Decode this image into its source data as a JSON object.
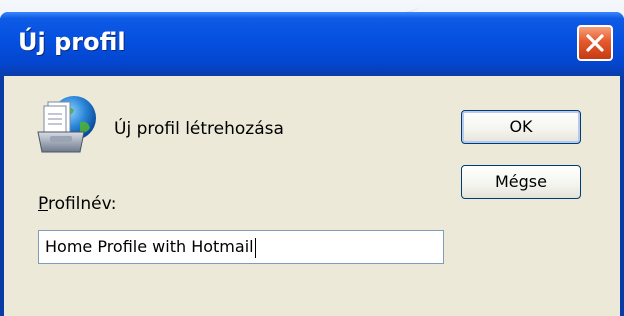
{
  "dialog": {
    "title": "Új profil",
    "create_text": "Új profil létrehozása",
    "ok_label": "OK",
    "cancel_label": "Mégse",
    "profile_label_accel": "P",
    "profile_label_rest": "rofilnév:",
    "profile_name_value": "Home Profile with Hotmail"
  },
  "icons": {
    "close": "close-icon",
    "app": "mail-profile-icon"
  },
  "colors": {
    "titlebar": "#0550df",
    "close_button": "#e45a2c",
    "dialog_background": "#ece9d8",
    "input_border": "#7f9db9",
    "button_border": "#003c74"
  }
}
